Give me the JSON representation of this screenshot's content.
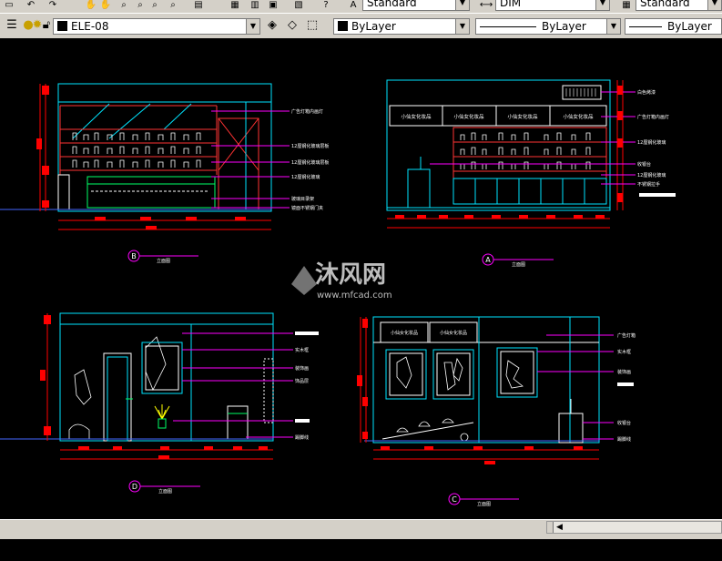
{
  "toolbar_top": {
    "text_style": "Standard",
    "dim_style": "DIM",
    "table_style": "Standard"
  },
  "layers_toolbar": {
    "current_layer": "ELE-08",
    "color": "ByLayer",
    "linetype": "ByLayer",
    "lineweight": "ByLayer"
  },
  "drawing": {
    "watermark_brand": "沐风网",
    "watermark_url": "www.mfcad.com",
    "views": [
      {
        "marker": "B",
        "title": "立面图"
      },
      {
        "marker": "A",
        "title": "立面图"
      },
      {
        "marker": "D",
        "title": "立面图"
      },
      {
        "marker": "C",
        "title": "立面图"
      }
    ],
    "panel_a_headers": [
      "小仙女化妆品",
      "小仙女化妆品",
      "小仙女化妆品",
      "小仙女化妆品"
    ],
    "panel_c_headers": [
      "小仙女化妆品",
      "小仙女化妆品"
    ],
    "labels_b": [
      "广告灯箱内画灯",
      "12厘钢化玻璃层板",
      "12厘钢化玻璃层板",
      "12厘钢化玻璃",
      "玻璃目录架",
      "镜面不锈钢门夹"
    ],
    "labels_a": [
      "白色烤漆",
      "广告灯箱内画灯",
      "12厘钢化玻璃",
      "收银台",
      "12厘钢化玻璃",
      "不锈钢拉手"
    ],
    "labels_d": [
      "实木框",
      "装饰画",
      "饰品层",
      "踢脚线"
    ],
    "labels_c": [
      "广告灯箱",
      "实木框",
      "装饰画",
      "收银台",
      "踢脚线"
    ]
  },
  "colors": {
    "canvas": "#000000",
    "cyan": "#00e5ff",
    "red": "#ff0000",
    "white": "#ffffff",
    "magenta": "#ff00ff",
    "yellow": "#ffff00",
    "green": "#00ff00"
  },
  "icons": [
    "new-icon",
    "undo-icon",
    "redo-icon",
    "pan-icon",
    "zoom-icon",
    "zoom-window-icon",
    "zoom-previous-icon",
    "properties-icon",
    "layer-icon",
    "help-icon",
    "style-icon",
    "layer-manager-icon",
    "lightbulb-icon",
    "sun-icon",
    "lock-icon",
    "make-current-icon",
    "layer-previous-icon",
    "layer-states-icon"
  ]
}
